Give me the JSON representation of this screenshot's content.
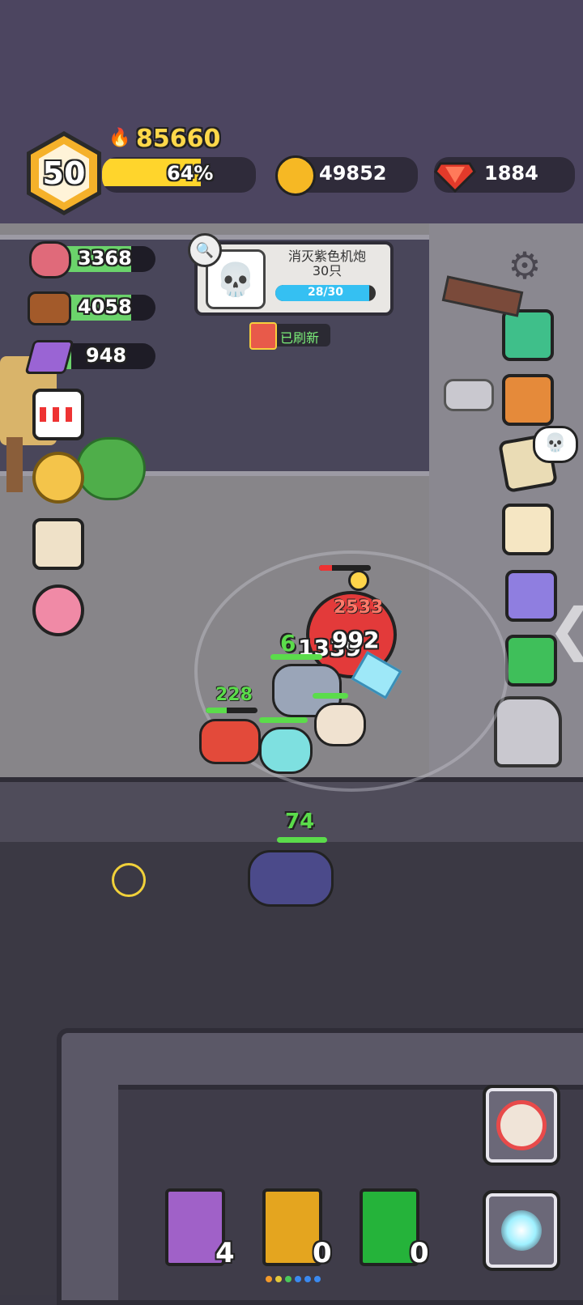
{
  "player": {
    "level": "50",
    "power": "85660",
    "exp_percent": "64%",
    "exp_fraction": 0.64
  },
  "currency": {
    "gold": "49852",
    "gems": "1884"
  },
  "resources": [
    {
      "name": "meat",
      "value": "3368",
      "fill": 0.8,
      "icon": "meat-icon"
    },
    {
      "name": "wood",
      "value": "4058",
      "fill": 0.8,
      "icon": "wood-icon"
    },
    {
      "name": "crystal",
      "value": "948",
      "fill": 0.1,
      "icon": "crystal-icon"
    }
  ],
  "quest": {
    "title": "消灭紫色机炮",
    "subtitle": "30只",
    "progress": "28/30",
    "progress_fraction": 0.933,
    "refresh_label": "已刷新"
  },
  "battle": {
    "damage_numbers": [
      "2533",
      "1339",
      "992",
      "6"
    ],
    "ally_numbers": [
      "228",
      "74"
    ]
  },
  "skill_books": [
    {
      "name": "lightning-book",
      "count": "4",
      "color": "#a061c8"
    },
    {
      "name": "wing-book",
      "count": "0",
      "color": "#e4a51f"
    },
    {
      "name": "heal-book",
      "count": "0",
      "color": "#25b33a"
    }
  ],
  "colors": {
    "exp_fill": "#ffd52c",
    "res_fill": "#6bd36b",
    "gem": "#e23a2a",
    "gold": "#f6b824",
    "quest_bar": "#35c0f2"
  }
}
